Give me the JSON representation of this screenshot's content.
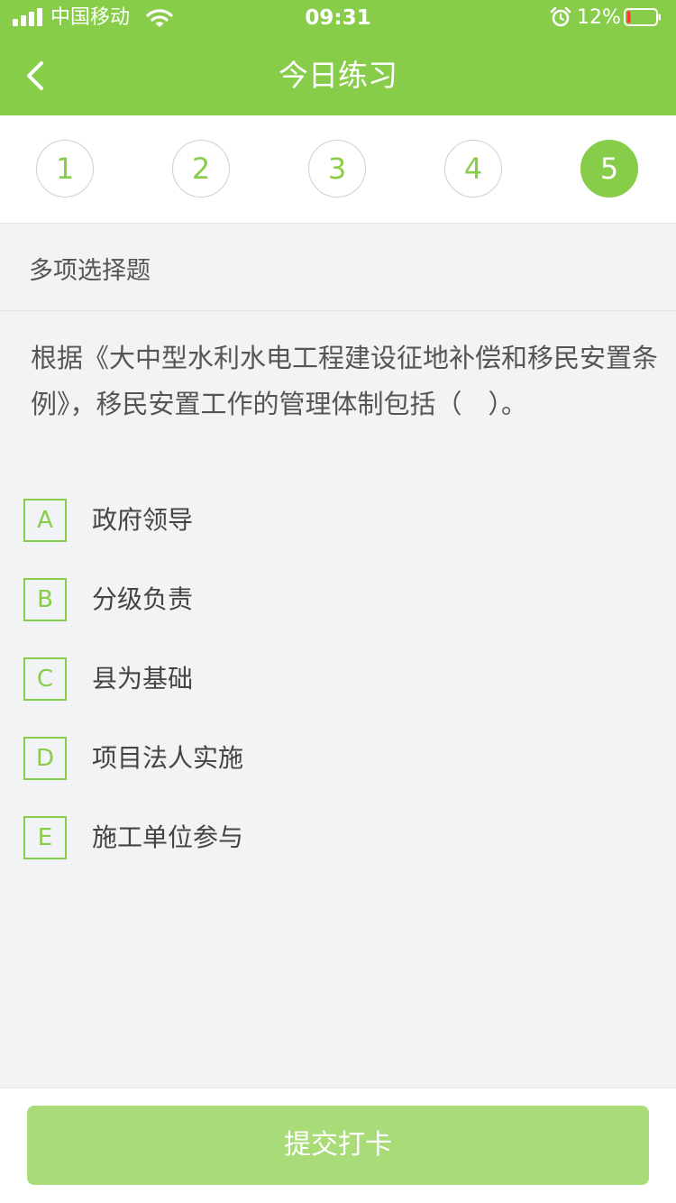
{
  "status_bar": {
    "carrier": "中国移动",
    "time": "09:31",
    "battery_percent": "12%",
    "icons": [
      "signal-icon",
      "wifi-icon",
      "alarm-icon",
      "battery-icon"
    ]
  },
  "nav": {
    "title": "今日练习",
    "back_icon": "chevron-left-icon"
  },
  "steps": {
    "items": [
      "1",
      "2",
      "3",
      "4",
      "5"
    ],
    "active": "5"
  },
  "question": {
    "type": "多项选择题",
    "text": "根据《大中型水利水电工程建设征地补偿和移民安置条例》，移民安置工作的管理体制包括（　）。",
    "options": [
      {
        "letter": "A",
        "text": "政府领导"
      },
      {
        "letter": "B",
        "text": "分级负责"
      },
      {
        "letter": "C",
        "text": "县为基础"
      },
      {
        "letter": "D",
        "text": "项目法人实施"
      },
      {
        "letter": "E",
        "text": "施工单位参与"
      }
    ]
  },
  "submit": {
    "label": "提交打卡"
  },
  "colors": {
    "accent": "#88cd4a",
    "submit_disabled": "#a9dc78",
    "background": "#f2f3f5",
    "battery_low": "#ff3b30"
  }
}
